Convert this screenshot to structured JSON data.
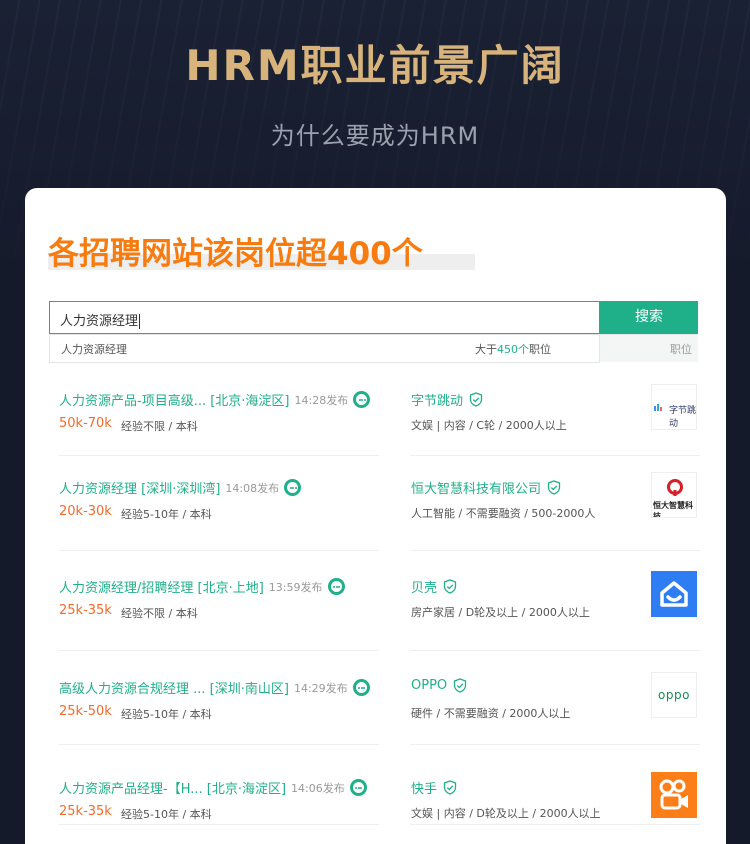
{
  "header": {
    "title": "HRM职业前景广阔",
    "subtitle": "为什么要成为HRM"
  },
  "card": {
    "heading": "各招聘网站该岗位超400个"
  },
  "search": {
    "value": "人力资源经理",
    "button_label": "搜索"
  },
  "suggestion": {
    "term": "人力资源经理",
    "count_prefix": "大于",
    "count_value": "450个",
    "count_suffix": "职位",
    "type": "职位"
  },
  "jobs": [
    {
      "title": "人力资源产品-项目高级... [北京·海淀区]",
      "time": "14:28发布",
      "salary": "50k-70k",
      "requirements": "经验不限 / 本科",
      "company": "字节跳动",
      "company_info": "文娱 | 内容 / C轮 / 2000人以上",
      "logo_text": "字节跳动"
    },
    {
      "title": "人力资源经理 [深圳·深圳湾]",
      "time": "14:08发布",
      "salary": "20k-30k",
      "requirements": "经验5-10年 / 本科",
      "company": "恒大智慧科技有限公司",
      "company_info": "人工智能 / 不需要融资 / 500-2000人",
      "logo_text": "恒大智慧科技"
    },
    {
      "title": "人力资源经理/招聘经理 [北京·上地]",
      "time": "13:59发布",
      "salary": "25k-35k",
      "requirements": "经验不限 / 本科",
      "company": "贝壳",
      "company_info": "房产家居 / D轮及以上 / 2000人以上",
      "logo_text": ""
    },
    {
      "title": "高级人力资源合规经理 ... [深圳·南山区]",
      "time": "14:29发布",
      "salary": "25k-50k",
      "requirements": "经验5-10年 / 本科",
      "company": "OPPO",
      "company_info": "硬件 / 不需要融资 / 2000人以上",
      "logo_text": "oppo"
    },
    {
      "title": "人力资源产品经理-【H... [北京·海淀区]",
      "time": "14:06发布",
      "salary": "25k-35k",
      "requirements": "经验5-10年 / 本科",
      "company": "快手",
      "company_info": "文娱 | 内容 / D轮及以上 / 2000人以上",
      "logo_text": ""
    }
  ],
  "colors": {
    "accent_green": "#1fb08a",
    "heading_orange": "#f77b0f",
    "salary_orange": "#f36b2b",
    "title_gold": "#d8b47c"
  }
}
